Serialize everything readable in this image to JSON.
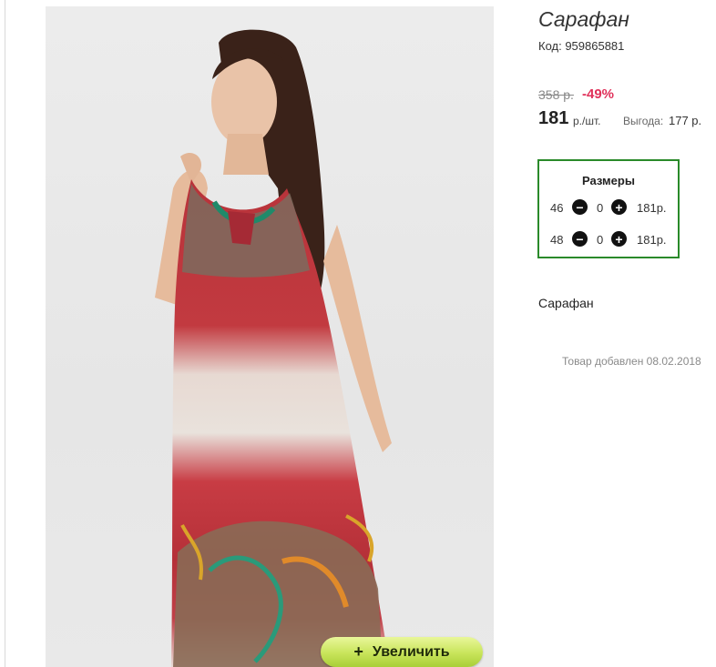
{
  "product": {
    "title": "Сарафан",
    "code": "Код: 959865881",
    "old_price": "358 р.",
    "discount": "-49%",
    "price": "181",
    "price_unit": "р./шт.",
    "benefit_label": "Выгода:",
    "benefit_value": "177 р.",
    "description": "Сарафан",
    "added": "Товар добавлен 08.02.2018"
  },
  "sizes": {
    "title": "Размеры",
    "rows": [
      {
        "size": "46",
        "qty": "0",
        "price": "181р."
      },
      {
        "size": "48",
        "qty": "0",
        "price": "181р."
      }
    ]
  },
  "zoom_button": {
    "icon": "+",
    "label": "Увеличить"
  },
  "icons": {
    "minus": "minus-circle-icon",
    "plus": "plus-circle-icon"
  },
  "colors": {
    "sizes_border": "#2a8a2a",
    "discount": "#e0315a",
    "zoom_button": "#c8e45a"
  }
}
